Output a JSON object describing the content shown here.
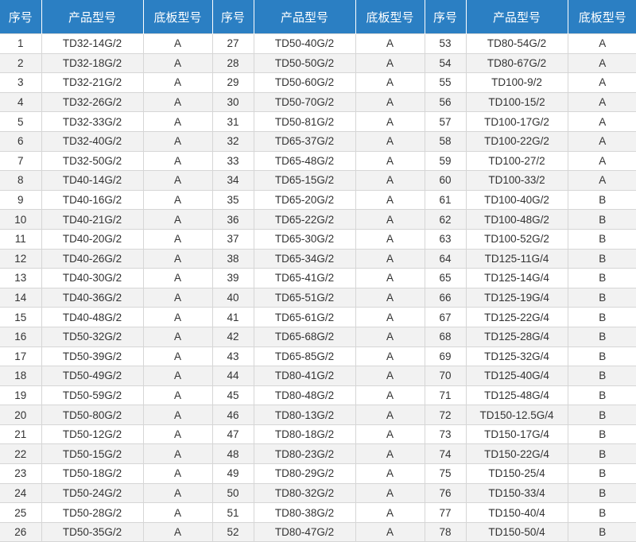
{
  "headers": [
    "序号",
    "产品型号",
    "底板型号",
    "序号",
    "产品型号",
    "底板型号",
    "序号",
    "产品型号",
    "底板型号"
  ],
  "rows": [
    [
      "1",
      "TD32-14G/2",
      "A",
      "27",
      "TD50-40G/2",
      "A",
      "53",
      "TD80-54G/2",
      "A"
    ],
    [
      "2",
      "TD32-18G/2",
      "A",
      "28",
      "TD50-50G/2",
      "A",
      "54",
      "TD80-67G/2",
      "A"
    ],
    [
      "3",
      "TD32-21G/2",
      "A",
      "29",
      "TD50-60G/2",
      "A",
      "55",
      "TD100-9/2",
      "A"
    ],
    [
      "4",
      "TD32-26G/2",
      "A",
      "30",
      "TD50-70G/2",
      "A",
      "56",
      "TD100-15/2",
      "A"
    ],
    [
      "5",
      "TD32-33G/2",
      "A",
      "31",
      "TD50-81G/2",
      "A",
      "57",
      "TD100-17G/2",
      "A"
    ],
    [
      "6",
      "TD32-40G/2",
      "A",
      "32",
      "TD65-37G/2",
      "A",
      "58",
      "TD100-22G/2",
      "A"
    ],
    [
      "7",
      "TD32-50G/2",
      "A",
      "33",
      "TD65-48G/2",
      "A",
      "59",
      "TD100-27/2",
      "A"
    ],
    [
      "8",
      "TD40-14G/2",
      "A",
      "34",
      "TD65-15G/2",
      "A",
      "60",
      "TD100-33/2",
      "A"
    ],
    [
      "9",
      "TD40-16G/2",
      "A",
      "35",
      "TD65-20G/2",
      "A",
      "61",
      "TD100-40G/2",
      "B"
    ],
    [
      "10",
      "TD40-21G/2",
      "A",
      "36",
      "TD65-22G/2",
      "A",
      "62",
      "TD100-48G/2",
      "B"
    ],
    [
      "11",
      "TD40-20G/2",
      "A",
      "37",
      "TD65-30G/2",
      "A",
      "63",
      "TD100-52G/2",
      "B"
    ],
    [
      "12",
      "TD40-26G/2",
      "A",
      "38",
      "TD65-34G/2",
      "A",
      "64",
      "TD125-11G/4",
      "B"
    ],
    [
      "13",
      "TD40-30G/2",
      "A",
      "39",
      "TD65-41G/2",
      "A",
      "65",
      "TD125-14G/4",
      "B"
    ],
    [
      "14",
      "TD40-36G/2",
      "A",
      "40",
      "TD65-51G/2",
      "A",
      "66",
      "TD125-19G/4",
      "B"
    ],
    [
      "15",
      "TD40-48G/2",
      "A",
      "41",
      "TD65-61G/2",
      "A",
      "67",
      "TD125-22G/4",
      "B"
    ],
    [
      "16",
      "TD50-32G/2",
      "A",
      "42",
      "TD65-68G/2",
      "A",
      "68",
      "TD125-28G/4",
      "B"
    ],
    [
      "17",
      "TD50-39G/2",
      "A",
      "43",
      "TD65-85G/2",
      "A",
      "69",
      "TD125-32G/4",
      "B"
    ],
    [
      "18",
      "TD50-49G/2",
      "A",
      "44",
      "TD80-41G/2",
      "A",
      "70",
      "TD125-40G/4",
      "B"
    ],
    [
      "19",
      "TD50-59G/2",
      "A",
      "45",
      "TD80-48G/2",
      "A",
      "71",
      "TD125-48G/4",
      "B"
    ],
    [
      "20",
      "TD50-80G/2",
      "A",
      "46",
      "TD80-13G/2",
      "A",
      "72",
      "TD150-12.5G/4",
      "B"
    ],
    [
      "21",
      "TD50-12G/2",
      "A",
      "47",
      "TD80-18G/2",
      "A",
      "73",
      "TD150-17G/4",
      "B"
    ],
    [
      "22",
      "TD50-15G/2",
      "A",
      "48",
      "TD80-23G/2",
      "A",
      "74",
      "TD150-22G/4",
      "B"
    ],
    [
      "23",
      "TD50-18G/2",
      "A",
      "49",
      "TD80-29G/2",
      "A",
      "75",
      "TD150-25/4",
      "B"
    ],
    [
      "24",
      "TD50-24G/2",
      "A",
      "50",
      "TD80-32G/2",
      "A",
      "76",
      "TD150-33/4",
      "B"
    ],
    [
      "25",
      "TD50-28G/2",
      "A",
      "51",
      "TD80-38G/2",
      "A",
      "77",
      "TD150-40/4",
      "B"
    ],
    [
      "26",
      "TD50-35G/2",
      "A",
      "52",
      "TD80-47G/2",
      "A",
      "78",
      "TD150-50/4",
      "B"
    ]
  ]
}
